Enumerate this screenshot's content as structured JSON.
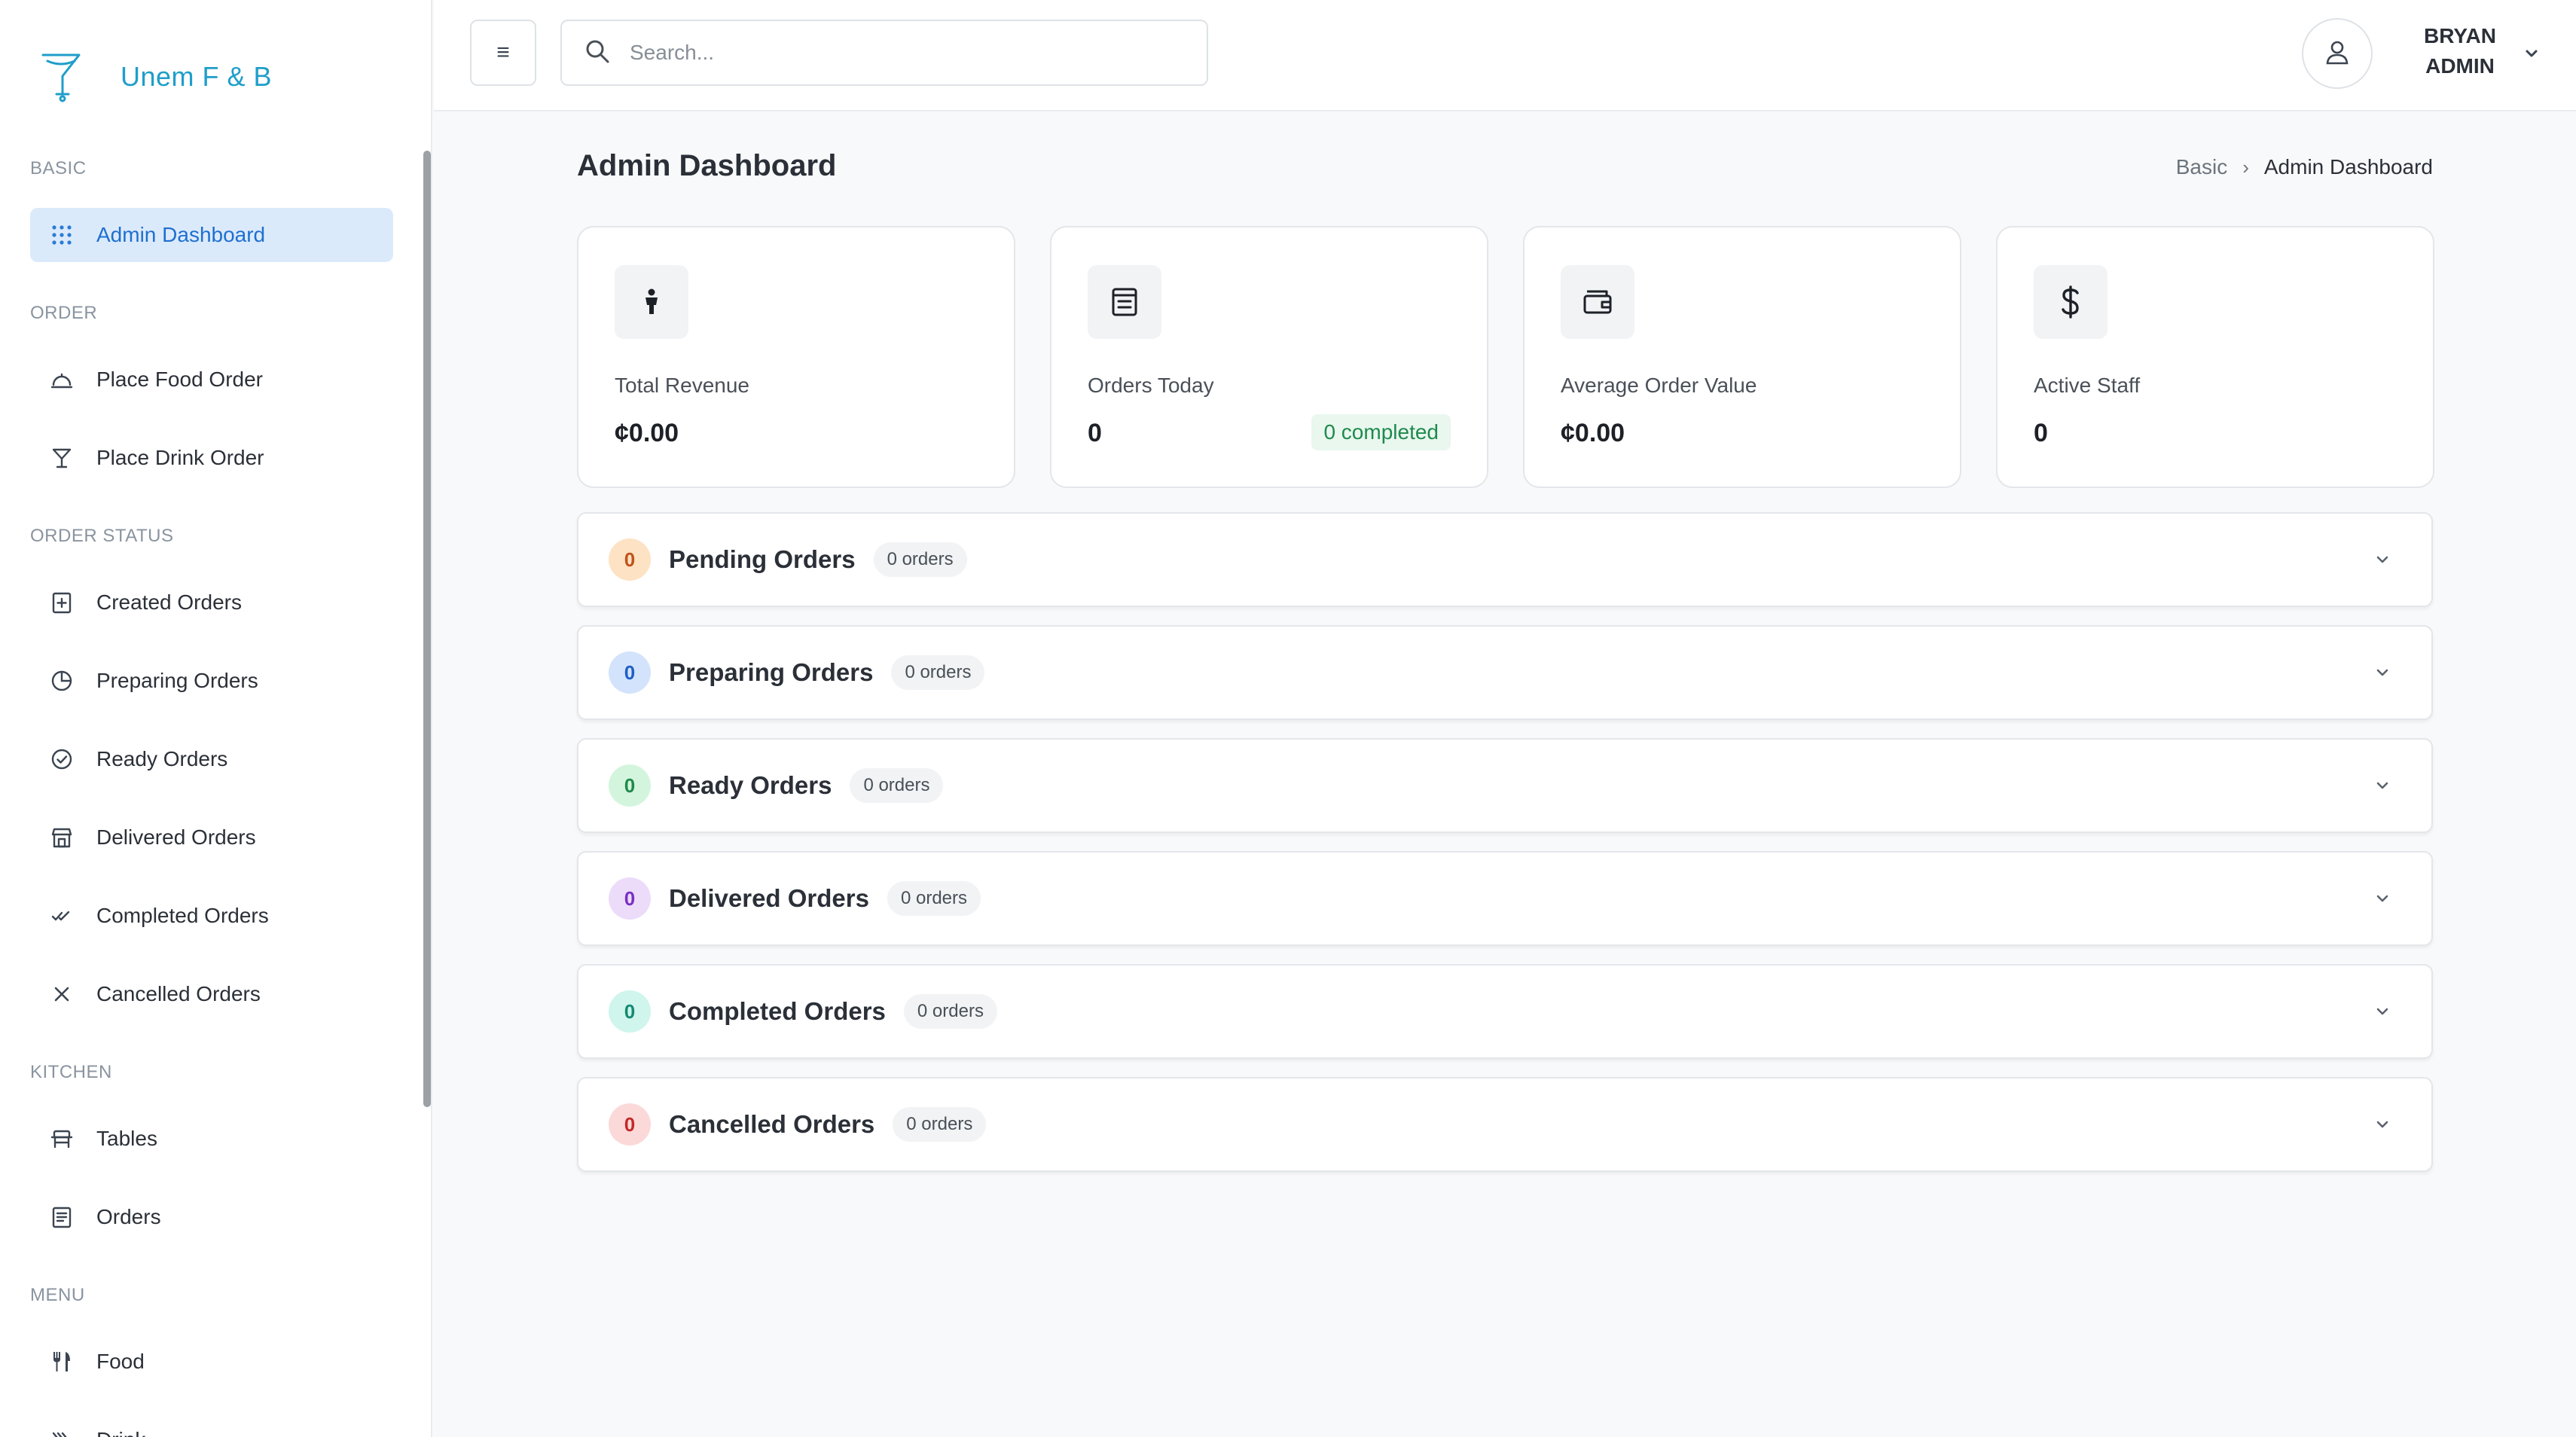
{
  "brand": {
    "name": "Unem F & B"
  },
  "sidebar": {
    "sections": [
      {
        "label": "BASIC"
      },
      {
        "label": "ORDER"
      },
      {
        "label": "ORDER STATUS"
      },
      {
        "label": "KITCHEN"
      },
      {
        "label": "MENU"
      }
    ],
    "items": [
      {
        "label": "Admin Dashboard",
        "icon": "grid-icon",
        "active": true
      },
      {
        "label": "Place Food Order",
        "icon": "cloche-icon"
      },
      {
        "label": "Place Drink Order",
        "icon": "cocktail-icon"
      },
      {
        "label": "Created Orders",
        "icon": "file-plus-icon"
      },
      {
        "label": "Preparing Orders",
        "icon": "clock-icon"
      },
      {
        "label": "Ready Orders",
        "icon": "check-circle-icon"
      },
      {
        "label": "Delivered Orders",
        "icon": "store-icon"
      },
      {
        "label": "Completed Orders",
        "icon": "double-check-icon"
      },
      {
        "label": "Cancelled Orders",
        "icon": "x-icon"
      },
      {
        "label": "Tables",
        "icon": "table-icon"
      },
      {
        "label": "Orders",
        "icon": "clipboard-icon"
      },
      {
        "label": "Food",
        "icon": "utensils-icon"
      },
      {
        "label": "Drink",
        "icon": "drink-icon"
      }
    ]
  },
  "topbar": {
    "menu_icon": "≡",
    "search_placeholder": "Search...",
    "user_name_line1": "BRYAN",
    "user_name_line2": "ADMIN"
  },
  "page": {
    "title": "Admin Dashboard",
    "breadcrumb": [
      "Basic",
      "Admin Dashboard"
    ],
    "breadcrumb_sep": "›"
  },
  "stats": [
    {
      "label": "Total Revenue",
      "value": "¢0.00",
      "icon": "person-icon"
    },
    {
      "label": "Orders Today",
      "value": "0",
      "badge": "0 completed",
      "icon": "receipt-icon"
    },
    {
      "label": "Average Order Value",
      "value": "¢0.00",
      "icon": "wallet-icon"
    },
    {
      "label": "Active Staff",
      "value": "0",
      "icon": "dollar-icon"
    }
  ],
  "orders": [
    {
      "title": "Pending Orders",
      "count": "0",
      "pill": "0 orders",
      "color_bg": "#fde2c4",
      "color_fg": "#c0531a"
    },
    {
      "title": "Preparing Orders",
      "count": "0",
      "pill": "0 orders",
      "color_bg": "#d3e3fb",
      "color_fg": "#1f5fc4"
    },
    {
      "title": "Ready Orders",
      "count": "0",
      "pill": "0 orders",
      "color_bg": "#d4f5dd",
      "color_fg": "#1f8a4c"
    },
    {
      "title": "Delivered Orders",
      "count": "0",
      "pill": "0 orders",
      "color_bg": "#ecdcfa",
      "color_fg": "#7a2fc2"
    },
    {
      "title": "Completed Orders",
      "count": "0",
      "pill": "0 orders",
      "color_bg": "#cff5ec",
      "color_fg": "#138a72"
    },
    {
      "title": "Cancelled Orders",
      "count": "0",
      "pill": "0 orders",
      "color_bg": "#fbd9d9",
      "color_fg": "#c22a2a"
    }
  ]
}
